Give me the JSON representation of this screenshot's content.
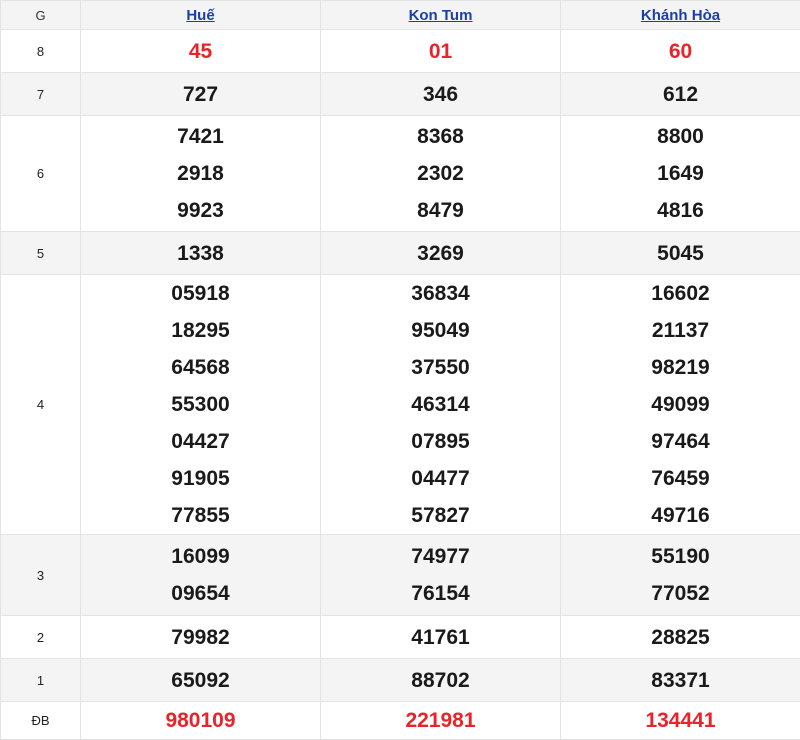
{
  "header": {
    "label": "G",
    "provinces": [
      "Huế",
      "Kon Tum",
      "Khánh Hòa"
    ]
  },
  "colors": {
    "accent_red": "#e8232a",
    "link_blue": "#1a3fa8"
  },
  "rows": [
    {
      "label": "8",
      "values": [
        [
          "45"
        ],
        [
          "01"
        ],
        [
          "60"
        ]
      ]
    },
    {
      "label": "7",
      "values": [
        [
          "727"
        ],
        [
          "346"
        ],
        [
          "612"
        ]
      ]
    },
    {
      "label": "6",
      "values": [
        [
          "7421",
          "2918",
          "9923"
        ],
        [
          "8368",
          "2302",
          "8479"
        ],
        [
          "8800",
          "1649",
          "4816"
        ]
      ]
    },
    {
      "label": "5",
      "values": [
        [
          "1338"
        ],
        [
          "3269"
        ],
        [
          "5045"
        ]
      ]
    },
    {
      "label": "4",
      "values": [
        [
          "05918",
          "18295",
          "64568",
          "55300",
          "04427",
          "91905",
          "77855"
        ],
        [
          "36834",
          "95049",
          "37550",
          "46314",
          "07895",
          "04477",
          "57827"
        ],
        [
          "16602",
          "21137",
          "98219",
          "49099",
          "97464",
          "76459",
          "49716"
        ]
      ]
    },
    {
      "label": "3",
      "values": [
        [
          "16099",
          "09654"
        ],
        [
          "74977",
          "76154"
        ],
        [
          "55190",
          "77052"
        ]
      ]
    },
    {
      "label": "2",
      "values": [
        [
          "79982"
        ],
        [
          "41761"
        ],
        [
          "28825"
        ]
      ]
    },
    {
      "label": "1",
      "values": [
        [
          "65092"
        ],
        [
          "88702"
        ],
        [
          "83371"
        ]
      ]
    },
    {
      "label": "ĐB",
      "values": [
        [
          "980109"
        ],
        [
          "221981"
        ],
        [
          "134441"
        ]
      ]
    }
  ]
}
